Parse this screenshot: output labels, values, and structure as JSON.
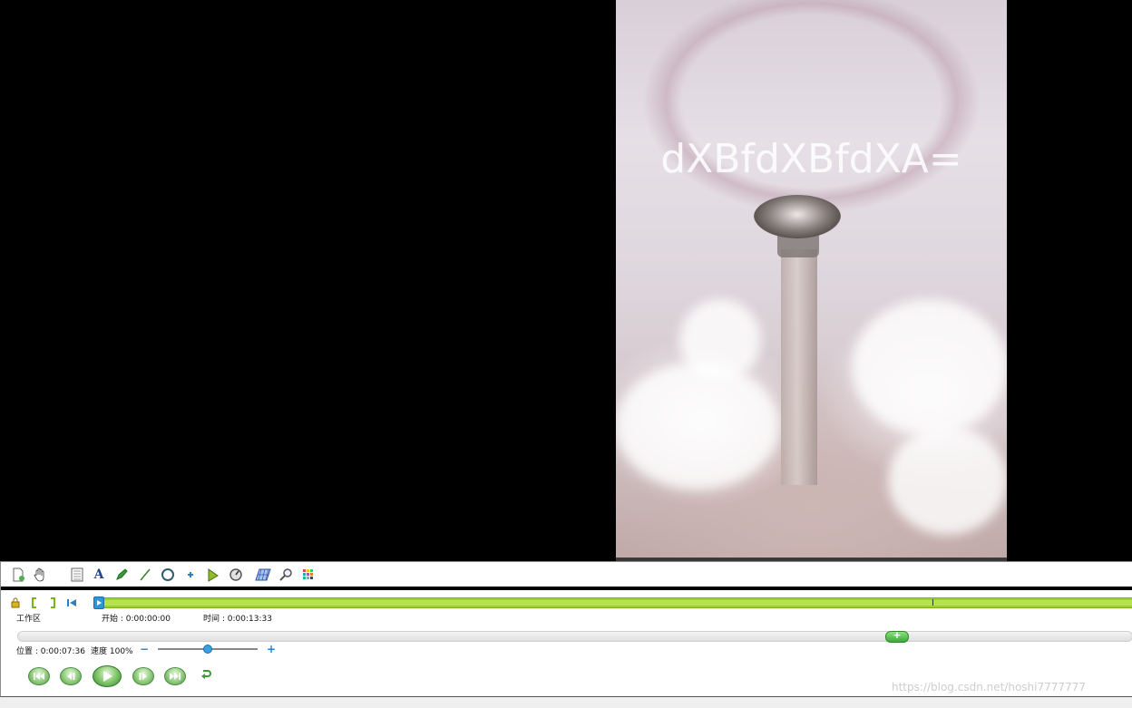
{
  "video": {
    "overlay_text": "dXBfdXBfdXA="
  },
  "toolbar": {
    "icons": [
      "new-file-icon",
      "hand-icon",
      "list-icon",
      "text-icon",
      "pen-icon",
      "line-icon",
      "circle-icon",
      "plus-icon",
      "triangle-icon",
      "dial-icon",
      "grid-icon",
      "zoom-icon",
      "color-grid-icon"
    ],
    "text_tool_glyph": "A"
  },
  "workspace": {
    "label": "工作区",
    "start_label": "开始 : 0:00:00:00",
    "time_label": "时间 : 0:00:13:33"
  },
  "playback": {
    "position_label": "位置 : 0:00:07:36",
    "speed_label": "速度 100%",
    "speed_minus": "−",
    "speed_plus": "+",
    "scrub_position_fraction": 0.78,
    "speed_fraction": 0.5
  },
  "colors": {
    "timeline_green": "#9bd233",
    "button_green": "#4d9b45",
    "handle_blue": "#2b97d9"
  },
  "watermark": "https://blog.csdn.net/hoshi7777777"
}
